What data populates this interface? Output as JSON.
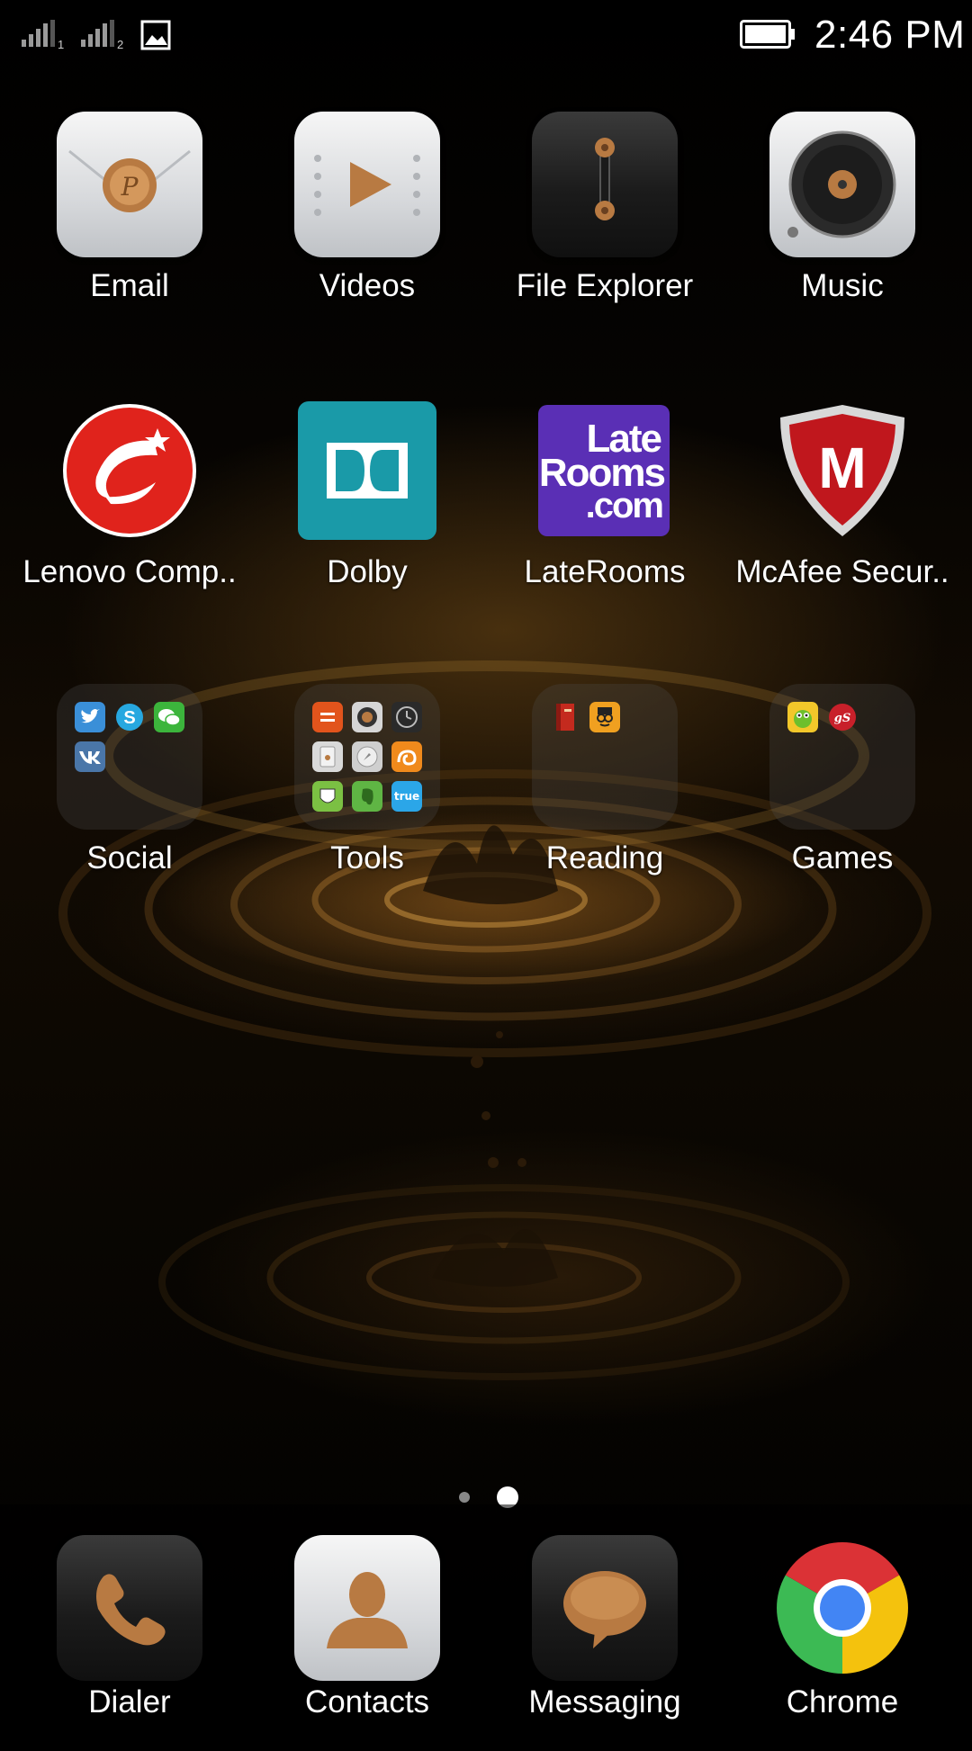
{
  "status_bar": {
    "sim1_label": "1",
    "sim2_label": "2",
    "time": "2:46 PM"
  },
  "apps": [
    {
      "label": "Email",
      "icon": "email-icon"
    },
    {
      "label": "Videos",
      "icon": "videos-icon"
    },
    {
      "label": "File Explorer",
      "icon": "file-explorer-icon"
    },
    {
      "label": "Music",
      "icon": "music-icon"
    },
    {
      "label": "Lenovo Comp..",
      "icon": "lenovo-companion-icon"
    },
    {
      "label": "Dolby",
      "icon": "dolby-icon"
    },
    {
      "label": "LateRooms",
      "icon": "laterooms-icon",
      "logo_text": [
        "Late",
        "Rooms",
        ".com"
      ]
    },
    {
      "label": "McAfee Secur..",
      "icon": "mcafee-icon",
      "logo_text": "M"
    }
  ],
  "folders": [
    {
      "label": "Social",
      "apps": [
        "twitter",
        "skype",
        "wechat",
        "vk"
      ]
    },
    {
      "label": "Tools",
      "apps": [
        "calculator",
        "camera",
        "clock",
        "notes",
        "compass",
        "uc-browser",
        "route",
        "evernote",
        "truecaller"
      ],
      "true_label": "true"
    },
    {
      "label": "Reading",
      "apps": [
        "book",
        "reader"
      ]
    },
    {
      "label": "Games",
      "apps": [
        "cut-the-rope",
        "game-gs"
      ],
      "gs_label": "gS"
    }
  ],
  "page_indicator": {
    "pages": 2,
    "current": 2
  },
  "dock": [
    {
      "label": "Dialer",
      "icon": "phone-icon"
    },
    {
      "label": "Contacts",
      "icon": "contacts-icon"
    },
    {
      "label": "Messaging",
      "icon": "messaging-icon"
    },
    {
      "label": "Chrome",
      "icon": "chrome-icon"
    }
  ],
  "colors": {
    "accent_copper": "#b87a42",
    "dolby_teal": "#1a9aa8",
    "laterooms_purple": "#5a2fb5",
    "mcafee_red": "#c0171d",
    "lenovo_red": "#e0231c"
  }
}
